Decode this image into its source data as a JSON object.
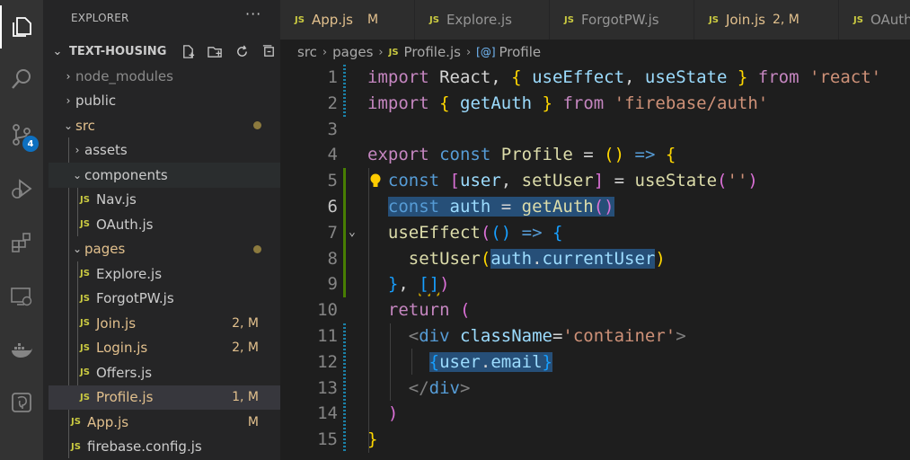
{
  "sidebar": {
    "title": "EXPLORER",
    "more": "···",
    "root": "TEXT-HOUSING",
    "tree": [
      {
        "label": "node_modules",
        "kind": "folder",
        "open": false
      },
      {
        "label": "public",
        "kind": "folder",
        "open": false
      },
      {
        "label": "src",
        "kind": "folder",
        "open": true
      },
      {
        "label": "assets",
        "kind": "folder",
        "open": false
      },
      {
        "label": "components",
        "kind": "folder",
        "open": true
      },
      {
        "label": "Nav.js",
        "kind": "file"
      },
      {
        "label": "OAuth.js",
        "kind": "file"
      },
      {
        "label": "pages",
        "kind": "folder",
        "open": true
      },
      {
        "label": "Explore.js",
        "kind": "file"
      },
      {
        "label": "ForgotPW.js",
        "kind": "file"
      },
      {
        "label": "Join.js",
        "kind": "file",
        "status": "2, M"
      },
      {
        "label": "Login.js",
        "kind": "file",
        "status": "2, M"
      },
      {
        "label": "Offers.js",
        "kind": "file"
      },
      {
        "label": "Profile.js",
        "kind": "file",
        "status": "1, M"
      },
      {
        "label": "App.js",
        "kind": "file",
        "status": "M"
      },
      {
        "label": "firebase.config.js",
        "kind": "file"
      }
    ]
  },
  "activity": {
    "source_control_badge": "4"
  },
  "tabs": [
    {
      "icon": "JS",
      "label": "App.js",
      "status": "M"
    },
    {
      "icon": "JS",
      "label": "Explore.js",
      "status": ""
    },
    {
      "icon": "JS",
      "label": "ForgotPW.js",
      "status": ""
    },
    {
      "icon": "JS",
      "label": "Join.js",
      "status": "2, M"
    },
    {
      "icon": "JS",
      "label": "OAuth.js",
      "status": ""
    }
  ],
  "breadcrumb": {
    "part1": "src",
    "part2": "pages",
    "file_icon": "JS",
    "file": "Profile.js",
    "symbol": "Profile"
  },
  "editor": {
    "line_numbers": [
      "1",
      "2",
      "3",
      "4",
      "5",
      "6",
      "7",
      "8",
      "9",
      "10",
      "11",
      "12",
      "13",
      "14",
      "15"
    ],
    "current_line": "6"
  },
  "colors": {
    "accent": "#0e70c0",
    "modified": "#e2c08d",
    "selection": "#264f78"
  }
}
